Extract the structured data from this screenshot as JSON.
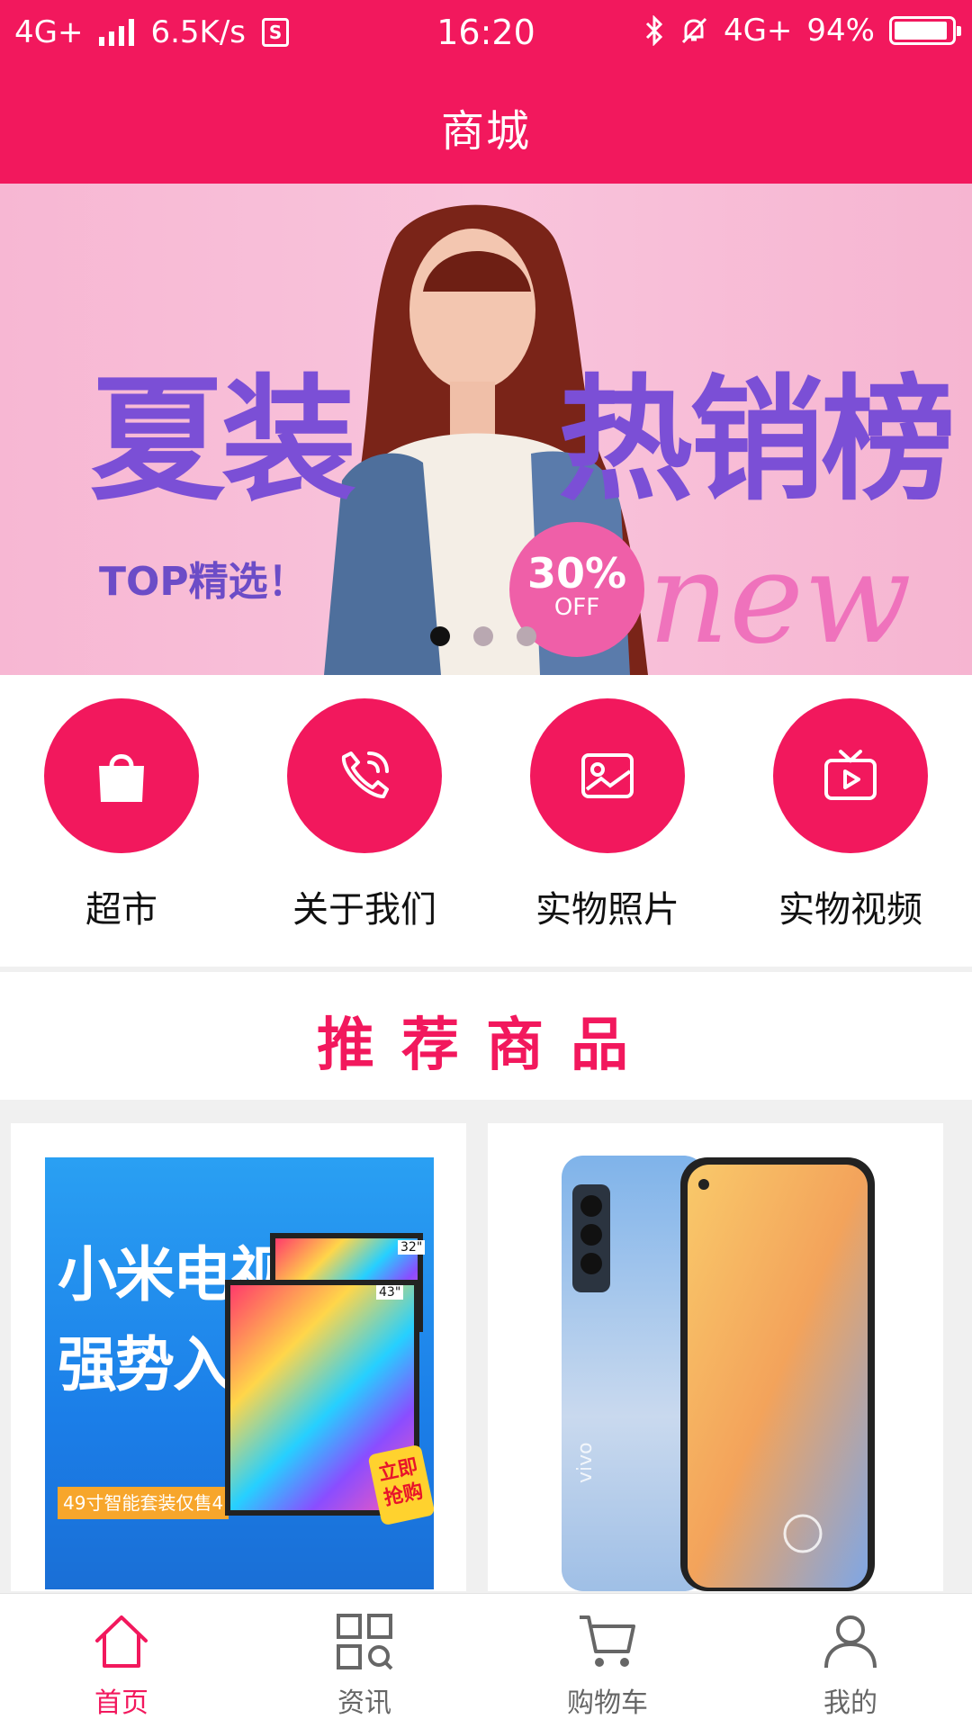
{
  "status_bar": {
    "network": "4G+",
    "speed": "6.5K/s",
    "sim_icon": "S",
    "time": "16:20",
    "network_right": "4G+",
    "battery": "94%",
    "battery_level": 0.94
  },
  "header": {
    "title": "商城"
  },
  "banner": {
    "headline_left": "夏装",
    "headline_right": "热销榜",
    "tagline": "TOP精选！",
    "discount": "30%",
    "discount_sub": "OFF",
    "script_word": "new",
    "slide_count": 3,
    "active_slide": 0
  },
  "categories": [
    {
      "label": "超市",
      "icon": "shopping-bag-icon"
    },
    {
      "label": "关于我们",
      "icon": "phone-call-icon"
    },
    {
      "label": "实物照片",
      "icon": "image-icon"
    },
    {
      "label": "实物视频",
      "icon": "tv-play-icon"
    }
  ],
  "section": {
    "title": "推荐商品"
  },
  "products": [
    {
      "image": "xiaomi-tv-promo",
      "line1": "小米电视",
      "line2": "强势入驻",
      "band": "49寸智能套装仅售4149元",
      "badge": "立即抢购",
      "size_a": "32\"",
      "size_b": "43\""
    },
    {
      "image": "vivo-phone",
      "brand": "vivo"
    }
  ],
  "bottom_nav": [
    {
      "label": "首页",
      "icon": "home-icon",
      "active": true
    },
    {
      "label": "资讯",
      "icon": "grid-search-icon",
      "active": false
    },
    {
      "label": "购物车",
      "icon": "cart-icon",
      "active": false
    },
    {
      "label": "我的",
      "icon": "user-icon",
      "active": false
    }
  ],
  "colors": {
    "accent": "#f2185d",
    "text": "#111111",
    "inactive": "#666666"
  }
}
